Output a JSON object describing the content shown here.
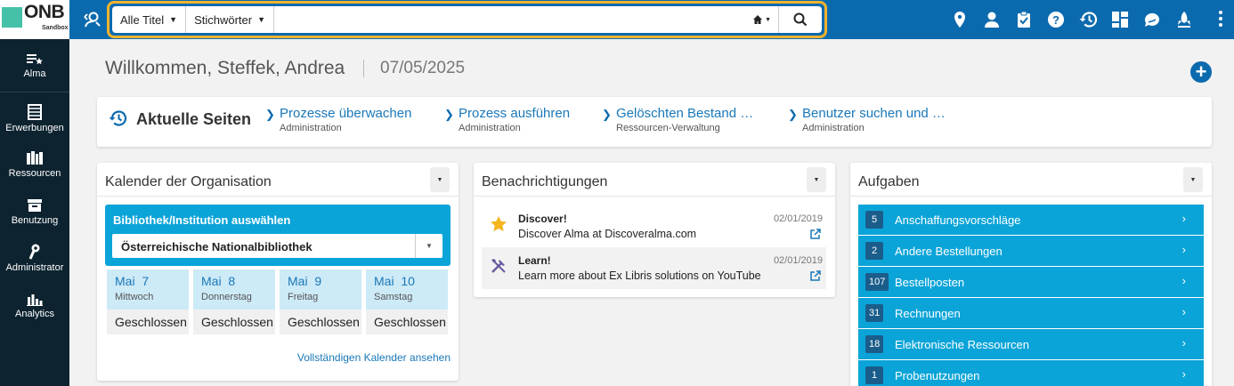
{
  "topbar": {
    "logo_text": "ONB",
    "logo_sub": "Sandbox",
    "search": {
      "scope": "Alle Titel",
      "field": "Stichwörter",
      "placeholder": "",
      "value": ""
    },
    "icons": [
      "location-pin-icon",
      "user-icon",
      "clipboard-icon",
      "help-icon",
      "history-icon",
      "dashboard-grid-icon",
      "chat-bubble-icon",
      "launch-icon"
    ]
  },
  "sidebar": {
    "items": [
      {
        "label": "Alma",
        "icon": "alma-icon"
      },
      {
        "label": "Erwerbungen",
        "icon": "ledger-icon"
      },
      {
        "label": "Ressourcen",
        "icon": "books-icon"
      },
      {
        "label": "Benutzung",
        "icon": "box-icon"
      },
      {
        "label": "Administrator",
        "icon": "wrench-icon"
      },
      {
        "label": "Analytics",
        "icon": "bar-chart-icon"
      }
    ]
  },
  "welcome": {
    "greeting": "Willkommen, Steffek, Andrea",
    "date": "07/05/2025"
  },
  "recent": {
    "title": "Aktuelle Seiten",
    "links": [
      {
        "title": "Prozesse überwachen",
        "sub": "Administration"
      },
      {
        "title": "Prozess ausführen",
        "sub": "Administration"
      },
      {
        "title": "Gelöschten Bestand …",
        "sub": "Ressourcen-Verwaltung"
      },
      {
        "title": "Benutzer suchen und …",
        "sub": "Administration"
      }
    ]
  },
  "calendar": {
    "title": "Kalender der Organisation",
    "select_label": "Bibliothek/Institution auswählen",
    "selected": "Österreichische Nationalbibliothek",
    "days": [
      {
        "day": "Mai  7",
        "weekday": "Mittwoch",
        "status": "Geschlossen"
      },
      {
        "day": "Mai  8",
        "weekday": "Donnerstag",
        "status": "Geschlossen"
      },
      {
        "day": "Mai  9",
        "weekday": "Freitag",
        "status": "Geschlossen"
      },
      {
        "day": "Mai  10",
        "weekday": "Samstag",
        "status": "Geschlossen"
      }
    ],
    "link": "Vollständigen Kalender ansehen"
  },
  "notifications": {
    "title": "Benachrichtigungen",
    "items": [
      {
        "title": "Discover!",
        "text": "Discover Alma at Discoveralma.com",
        "date": "02/01/2019",
        "icon": "star-icon"
      },
      {
        "title": "Learn!",
        "text": "Learn more about Ex Libris solutions on YouTube",
        "date": "02/01/2019",
        "icon": "tools-icon"
      }
    ]
  },
  "tasks": {
    "title": "Aufgaben",
    "items": [
      {
        "count": "5",
        "label": "Anschaffungsvorschläge"
      },
      {
        "count": "2",
        "label": "Andere Bestellungen"
      },
      {
        "count": "107",
        "label": "Bestellposten"
      },
      {
        "count": "31",
        "label": "Rechnungen"
      },
      {
        "count": "18",
        "label": "Elektronische Ressourcen"
      },
      {
        "count": "1",
        "label": "Probenutzungen"
      }
    ]
  },
  "colors": {
    "topbar": "#0b6aae",
    "sidebar": "#0d2330",
    "accent_blue": "#0ba4d8",
    "search_highlight": "#f0b32e"
  }
}
